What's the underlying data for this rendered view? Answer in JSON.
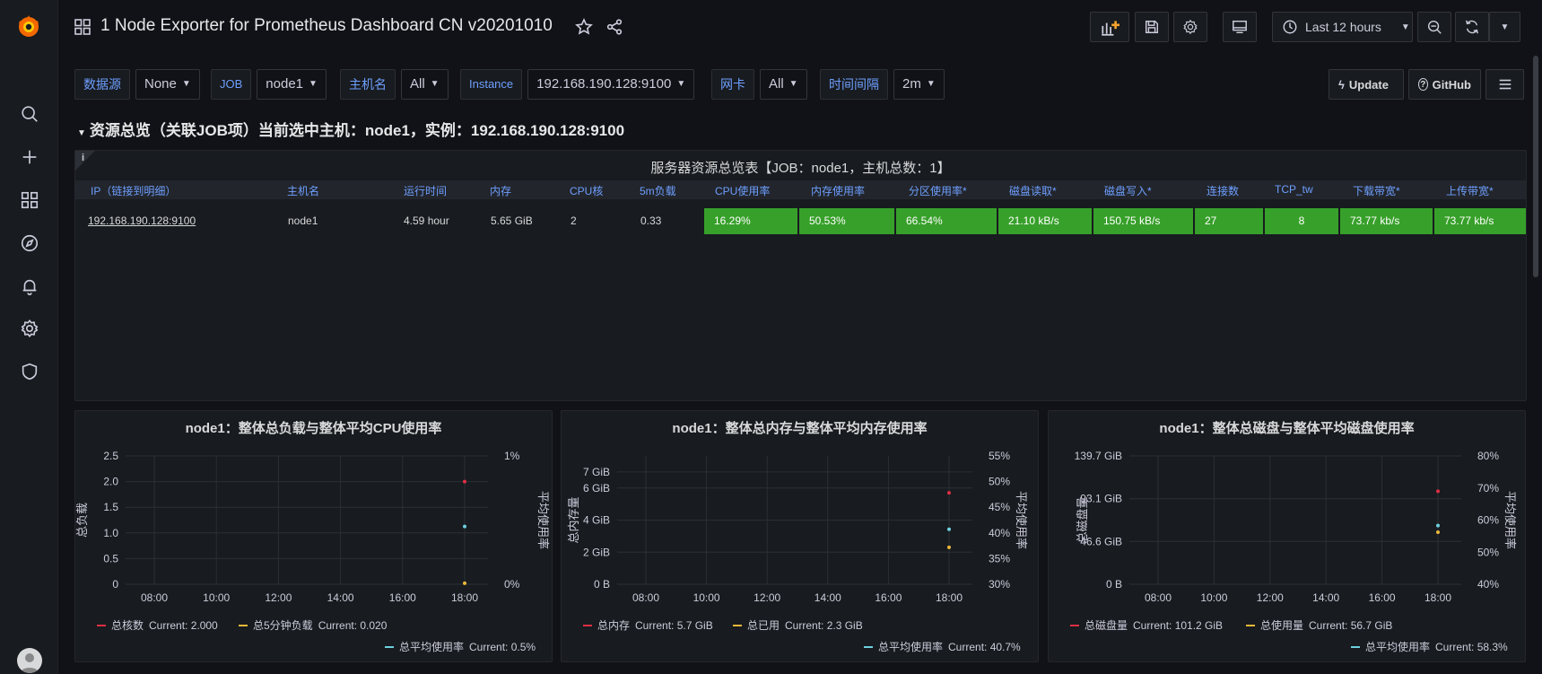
{
  "dashboard": {
    "title": "1 Node Exporter for Prometheus Dashboard CN v20201010",
    "time_range": "Last 12 hours"
  },
  "variables": [
    {
      "label": "数据源",
      "value": "None"
    },
    {
      "label": "JOB",
      "value": "node1"
    },
    {
      "label": "主机名",
      "value": "All"
    },
    {
      "label": "Instance",
      "value": "192.168.190.128:9100"
    },
    {
      "label": "网卡",
      "value": "All"
    },
    {
      "label": "时间间隔",
      "value": "2m"
    }
  ],
  "links": {
    "update": "Update",
    "github": "GitHub"
  },
  "row_title": "资源总览（关联JOB项）当前选中主机：node1，实例：192.168.190.128:9100",
  "table": {
    "info": "i",
    "title": "服务器资源总览表【JOB：node1，主机总数：1】",
    "headers": [
      "IP（链接到明细）",
      "主机名",
      "运行时间",
      "内存",
      "CPU核",
      "5m负载",
      "CPU使用率",
      "内存使用率",
      "分区使用率*",
      "磁盘读取*",
      "磁盘写入*",
      "连接数",
      "TCP_tw",
      "下载带宽*",
      "上传带宽*"
    ],
    "row": [
      "192.168.190.128:9100",
      "node1",
      "4.59 hour",
      "5.65 GiB",
      "2",
      "0.33",
      "16.29%",
      "50.53%",
      "66.54%",
      "21.10 kB/s",
      "150.75 kB/s",
      "27",
      "8",
      "73.77 kb/s",
      "73.77 kb/s"
    ],
    "cell_color": "#37a02a"
  },
  "chart_data": [
    {
      "type": "line",
      "title": "node1：整体总负载与整体平均CPU使用率",
      "ylabel": "总负载",
      "y2label": "平均使用率",
      "x_ticks": [
        "08:00",
        "10:00",
        "12:00",
        "14:00",
        "16:00",
        "18:00"
      ],
      "y_ticks": [
        "2.5",
        "2.0",
        "1.5",
        "1.0",
        "0.5",
        "0"
      ],
      "y2_ticks": [
        "1%",
        "0%"
      ],
      "ylim": [
        0,
        2.5
      ],
      "y2lim": [
        0,
        1
      ],
      "series": [
        {
          "name": "总核数",
          "color": "#e02f44",
          "axis": "left",
          "last_x": "18:00",
          "last_value": 2.0,
          "current": "Current: 2.000"
        },
        {
          "name": "总5分钟负载",
          "color": "#eab839",
          "axis": "left",
          "last_x": "18:00",
          "last_value": 0.02,
          "current": "Current: 0.020"
        },
        {
          "name": "总平均使用率",
          "color": "#6ed0e0",
          "axis": "right",
          "last_x": "18:00",
          "last_value": 0.45,
          "current": "Current: 0.5%"
        }
      ]
    },
    {
      "type": "line",
      "title": "node1：整体总内存与整体平均内存使用率",
      "ylabel": "总内存量",
      "y2label": "平均使用率",
      "x_ticks": [
        "08:00",
        "10:00",
        "12:00",
        "14:00",
        "16:00",
        "18:00"
      ],
      "y_ticks": [
        "7 GiB",
        "6 GiB",
        "4 GiB",
        "2 GiB",
        "0 B"
      ],
      "y2_ticks": [
        "55%",
        "50%",
        "45%",
        "40%",
        "35%",
        "30%"
      ],
      "ylim": [
        0,
        8
      ],
      "y2lim": [
        30,
        55
      ],
      "series": [
        {
          "name": "总内存",
          "color": "#e02f44",
          "axis": "left",
          "last_x": "18:00",
          "last_value": 5.7,
          "current": "Current: 5.7 GiB"
        },
        {
          "name": "总已用",
          "color": "#eab839",
          "axis": "left",
          "last_x": "18:00",
          "last_value": 2.3,
          "current": "Current: 2.3 GiB"
        },
        {
          "name": "总平均使用率",
          "color": "#6ed0e0",
          "axis": "right",
          "last_x": "18:00",
          "last_value": 40.7,
          "current": "Current: 40.7%"
        }
      ]
    },
    {
      "type": "line",
      "title": "node1：整体总磁盘与整体平均磁盘使用率",
      "ylabel": "总磁盘量",
      "y2label": "平均使用率",
      "x_ticks": [
        "08:00",
        "10:00",
        "12:00",
        "14:00",
        "16:00",
        "18:00"
      ],
      "y_ticks": [
        "139.7 GiB",
        "93.1 GiB",
        "46.6 GiB",
        "0 B"
      ],
      "y2_ticks": [
        "80%",
        "70%",
        "60%",
        "50%",
        "40%"
      ],
      "ylim": [
        0,
        139.7
      ],
      "y2lim": [
        40,
        80
      ],
      "series": [
        {
          "name": "总磁盘量",
          "color": "#e02f44",
          "axis": "left",
          "last_x": "18:00",
          "last_value": 101.2,
          "current": "Current: 101.2 GiB"
        },
        {
          "name": "总使用量",
          "color": "#eab839",
          "axis": "left",
          "last_x": "18:00",
          "last_value": 56.7,
          "current": "Current: 56.7 GiB"
        },
        {
          "name": "总平均使用率",
          "color": "#6ed0e0",
          "axis": "right",
          "last_x": "18:00",
          "last_value": 58.3,
          "current": "Current: 58.3%"
        }
      ]
    }
  ]
}
